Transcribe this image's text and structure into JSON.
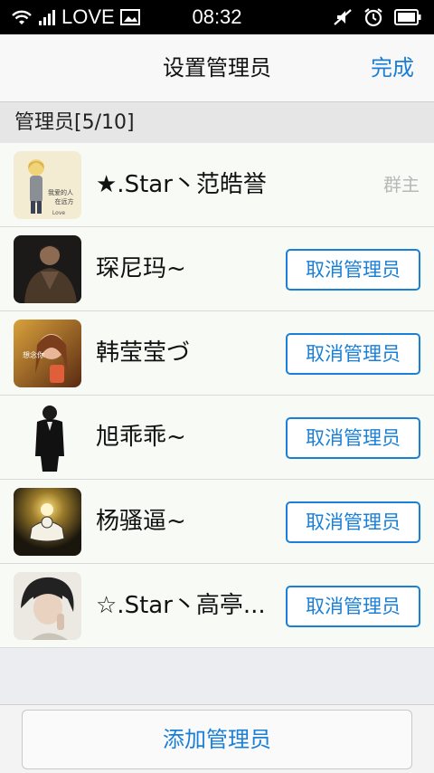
{
  "status_bar": {
    "carrier": "LOVE",
    "time": "08:32",
    "icons": [
      "wifi-icon",
      "signal-icon",
      "image-icon",
      "mute-icon",
      "alarm-icon",
      "battery-icon"
    ]
  },
  "nav": {
    "title": "设置管理员",
    "done_label": "完成"
  },
  "section": {
    "title": "管理员[5/10]"
  },
  "members": [
    {
      "name": "★.Star丶范皓誉",
      "role": "群主"
    },
    {
      "name": "琛尼玛~",
      "action": "取消管理员"
    },
    {
      "name": "韩莹莹づ",
      "action": "取消管理员"
    },
    {
      "name": "旭乖乖~",
      "action": "取消管理员"
    },
    {
      "name": "杨骚逼~",
      "action": "取消管理员"
    },
    {
      "name": "☆.Star丶高亭...",
      "action": "取消管理员"
    }
  ],
  "avatar_texts": {
    "a0_line1": "我爱的人",
    "a0_line2": "在远方",
    "a0_line3": "Love",
    "a2_text": "想念你"
  },
  "bottom": {
    "add_label": "添加管理员"
  },
  "colors": {
    "accent": "#1a7fd6",
    "row_bg": "#f7faf5",
    "owner_badge": "#b8b8b8"
  }
}
